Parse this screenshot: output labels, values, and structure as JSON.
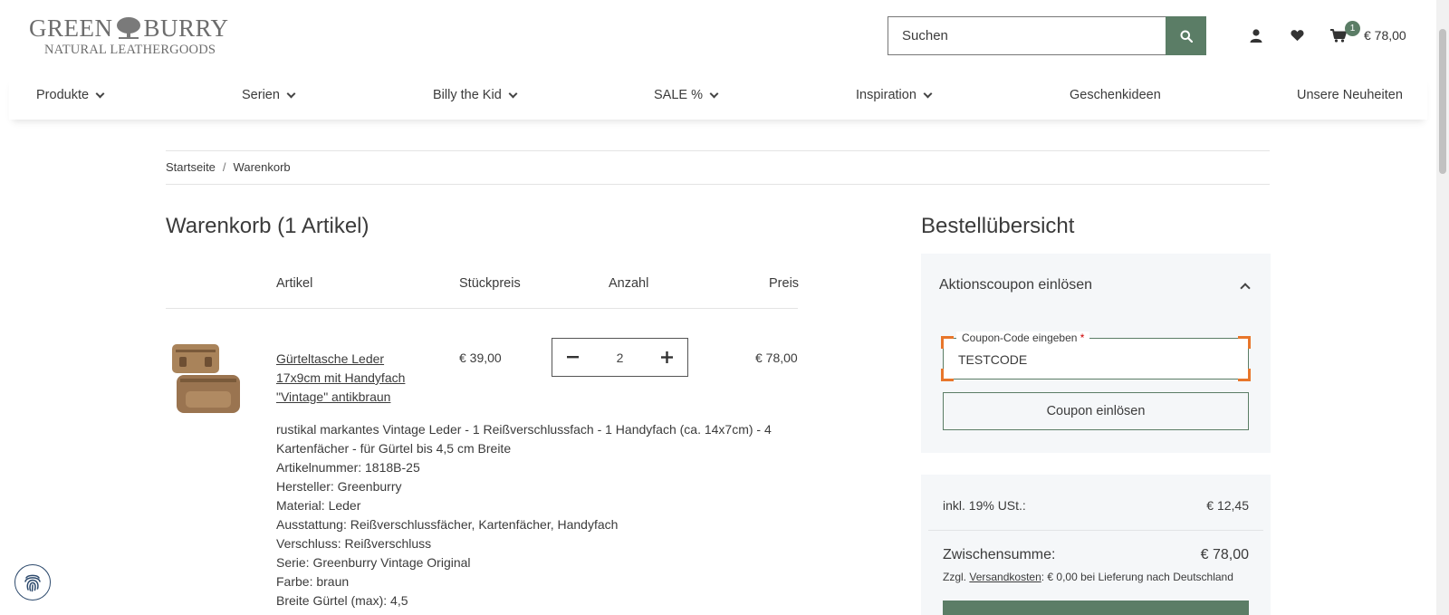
{
  "brand": {
    "line1_left": "GREEN",
    "line1_right": "BURRY",
    "line2": "NATURAL LEATHERGOODS"
  },
  "search": {
    "placeholder": "Suchen"
  },
  "header": {
    "cart_count": "1",
    "cart_total": "€ 78,00"
  },
  "nav": {
    "items": [
      {
        "label": "Produkte"
      },
      {
        "label": "Serien"
      },
      {
        "label": "Billy the Kid"
      },
      {
        "label": "SALE %"
      },
      {
        "label": "Inspiration"
      },
      {
        "label": "Geschenkideen"
      },
      {
        "label": "Unsere Neuheiten"
      }
    ]
  },
  "breadcrumb": {
    "home": "Startseite",
    "sep": "/",
    "current": "Warenkorb"
  },
  "cart": {
    "title": "Warenkorb (1 Artikel)",
    "columns": {
      "article": "Artikel",
      "unit_price": "Stückpreis",
      "quantity": "Anzahl",
      "price": "Preis"
    },
    "item": {
      "name": "Gürteltasche Leder 17x9cm mit Handyfach \"Vintage\" antikbraun",
      "unit_price": "€ 39,00",
      "quantity": "2",
      "line_total": "€ 78,00",
      "details": [
        "rustikal markantes Vintage Leder - 1 Reißverschlussfach - 1 Handyfach (ca. 14x7cm) - 4 Kartenfächer - für Gürtel bis 4,5 cm Breite",
        "Artikelnummer: 1818B-25",
        "Hersteller: Greenburry",
        "Material: Leder",
        "Ausstattung: Reißverschlussfächer, Kartenfächer, Handyfach",
        "Verschluss: Reißverschluss",
        "Serie: Greenburry Vintage Original",
        "Farbe: braun",
        "Breite Gürtel (max): 4,5"
      ]
    }
  },
  "summary": {
    "title": "Bestellübersicht",
    "coupon": {
      "title": "Aktionscoupon einlösen",
      "field_label": "Coupon-Code eingeben",
      "required_mark": "*",
      "value": "TESTCODE",
      "button": "Coupon einlösen"
    },
    "vat_label": "inkl. 19% USt.:",
    "vat_value": "€ 12,45",
    "subtotal_label": "Zwischensumme:",
    "subtotal_value": "€ 78,00",
    "shipping_prefix": "Zzgl.",
    "shipping_link": "Versandkosten",
    "shipping_suffix": ": € 0,00 bei Lieferung nach Deutschland"
  },
  "colors": {
    "accent": "#5b7d66",
    "focus_marker": "#e8762b",
    "panel_bg": "#f5f7f9"
  }
}
